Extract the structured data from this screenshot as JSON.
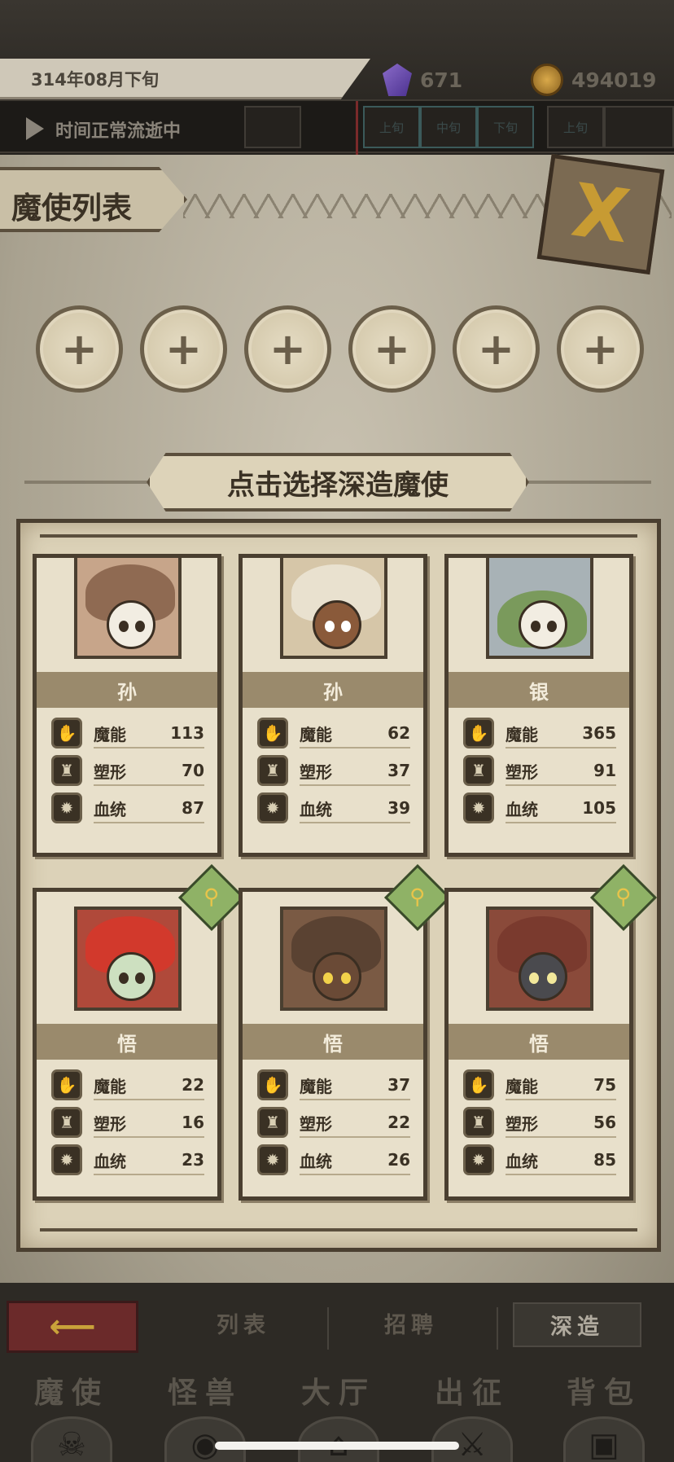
{
  "hud": {
    "date": "314年08月下旬",
    "gems": "671",
    "coins": "494019",
    "time_status": "时间正常流逝中",
    "segments": [
      "",
      "上旬",
      "中旬",
      "下旬",
      "上旬",
      ""
    ]
  },
  "panel": {
    "title": "魔使列表",
    "close_label": "X",
    "slot_plus": "+",
    "select_prompt": "点击选择深造魔使"
  },
  "stat_labels": {
    "mana": "魔能",
    "shape": "塑形",
    "blood": "血统"
  },
  "characters": [
    {
      "rank": "孙",
      "mana": "113",
      "shape": "70",
      "blood": "87",
      "badge": false
    },
    {
      "rank": "孙",
      "mana": "62",
      "shape": "37",
      "blood": "39",
      "badge": false
    },
    {
      "rank": "银",
      "mana": "365",
      "shape": "91",
      "blood": "105",
      "badge": false
    },
    {
      "rank": "悟",
      "mana": "22",
      "shape": "16",
      "blood": "23",
      "badge": true
    },
    {
      "rank": "悟",
      "mana": "37",
      "shape": "22",
      "blood": "26",
      "badge": true
    },
    {
      "rank": "悟",
      "mana": "75",
      "shape": "56",
      "blood": "85",
      "badge": true
    }
  ],
  "sub_tabs": {
    "list": "列表",
    "recruit": "招聘",
    "advance": "深造"
  },
  "main_tabs": [
    "魔使",
    "怪兽",
    "大厅",
    "出征",
    "背包"
  ],
  "colors": {
    "accent_gold": "#c79b33",
    "badge_green": "#8fb266",
    "back_red": "#6b2a2a"
  }
}
